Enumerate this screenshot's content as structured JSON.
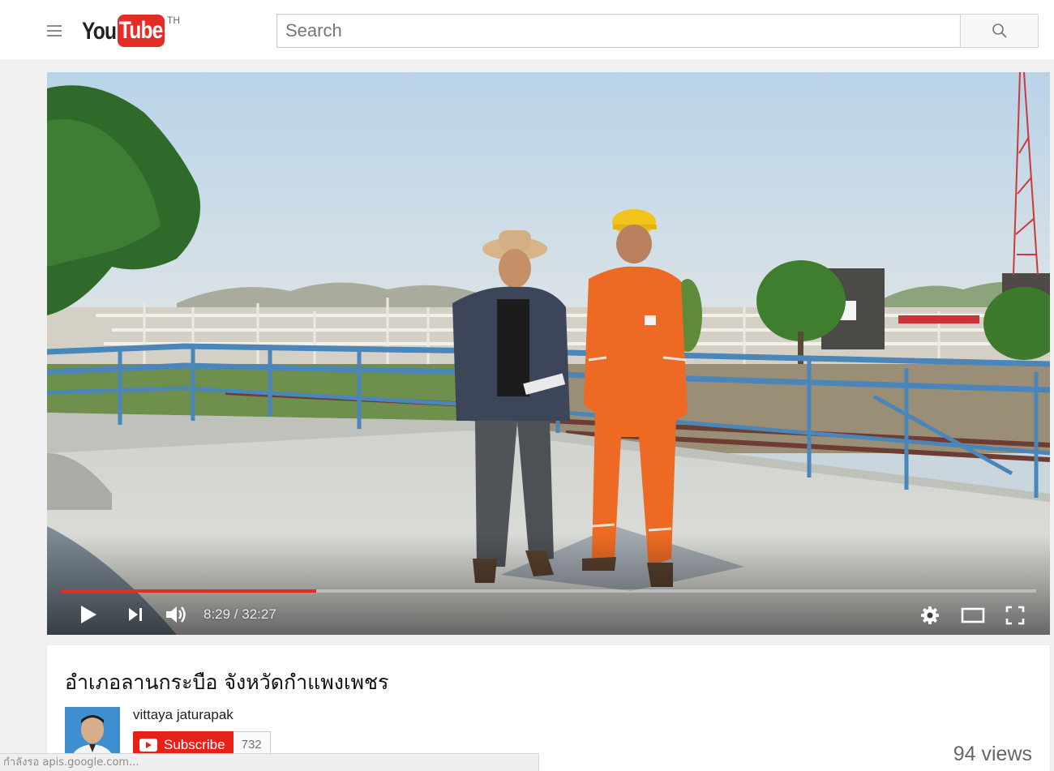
{
  "header": {
    "logo_you": "You",
    "logo_tube": "Tube",
    "logo_country": "TH",
    "search_placeholder": "Search"
  },
  "player": {
    "current_time": "8:29",
    "duration": "32:27",
    "time_display": "8:29 / 32:27",
    "progress_played": 0.262,
    "progress_loaded": 0.262,
    "colors": {
      "played": "#e52d27",
      "controls": "#ffffff"
    },
    "icons": [
      "play-icon",
      "next-icon",
      "volume-icon",
      "settings-icon",
      "theater-icon",
      "fullscreen-icon"
    ]
  },
  "video": {
    "title": "อำเภอลานกระบือ จังหวัดกำแพงเพชร",
    "channel_name": "vittaya jaturapak",
    "subscribe_label": "Subscribe",
    "subscriber_count": "732",
    "views": "94 views"
  },
  "status_bar": {
    "text": "กำลังรอ apis.google.com..."
  },
  "colors": {
    "brand_red": "#e52d27",
    "subscribe_red": "#e62117",
    "page_bg": "#f1f1f1"
  }
}
